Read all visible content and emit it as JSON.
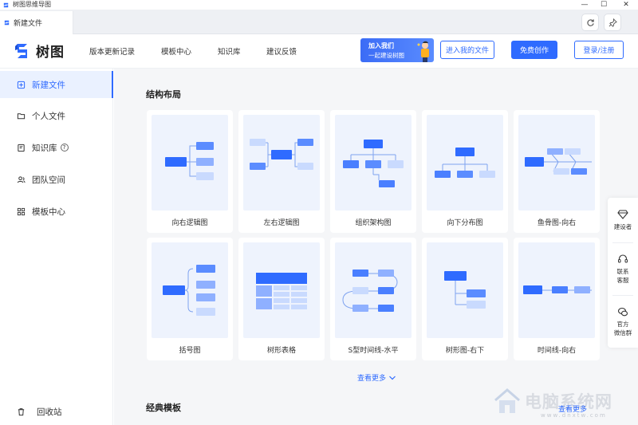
{
  "window": {
    "title": "树图思维导图",
    "controls": [
      "—",
      "☐",
      "✕"
    ]
  },
  "tab": {
    "label": "新建文件"
  },
  "tab_actions": [
    {
      "name": "refresh-icon"
    },
    {
      "name": "pin-icon"
    }
  ],
  "header": {
    "brand": "树图",
    "nav": [
      "版本更新记录",
      "模板中心",
      "知识库",
      "建议反馈"
    ],
    "promo": {
      "line1": "加入我们",
      "line2": "一起建设树图"
    },
    "enter_files": "进入我的文件",
    "create_free": "免费创作",
    "login": "登录/注册"
  },
  "sidebar": {
    "items": [
      {
        "label": "新建文件",
        "icon": "new-file-icon",
        "active": true
      },
      {
        "label": "个人文件",
        "icon": "folder-icon"
      },
      {
        "label": "知识库",
        "icon": "book-icon",
        "help": "?"
      },
      {
        "label": "团队空间",
        "icon": "team-icon"
      },
      {
        "label": "模板中心",
        "icon": "grid-icon"
      }
    ],
    "recycle": "回收站"
  },
  "main": {
    "structure_title": "结构布局",
    "cards": [
      {
        "label": "向右逻辑图"
      },
      {
        "label": "左右逻辑图"
      },
      {
        "label": "组织架构图"
      },
      {
        "label": "向下分布图"
      },
      {
        "label": "鱼骨图-向右"
      },
      {
        "label": "括号图"
      },
      {
        "label": "树形表格"
      },
      {
        "label": "S型时间线-水平"
      },
      {
        "label": "树形图-右下"
      },
      {
        "label": "时间线-向右"
      }
    ],
    "see_more": "查看更多",
    "classic_title": "经典模板"
  },
  "float_panel": [
    {
      "label1": "建设者",
      "label2": "",
      "icon": "diamond-icon"
    },
    {
      "label1": "联系",
      "label2": "客服",
      "icon": "headset-icon"
    },
    {
      "label1": "官方",
      "label2": "微信群",
      "icon": "wechat-icon"
    }
  ],
  "watermark": {
    "text": "电脑系统网",
    "sub": "www.dnxtw.com",
    "overlay": "查看更多"
  },
  "colors": {
    "accent": "#2f6bff",
    "node_dark": "#2f6bff",
    "node_mid": "#6a9bff",
    "node_light": "#c9dafe"
  }
}
